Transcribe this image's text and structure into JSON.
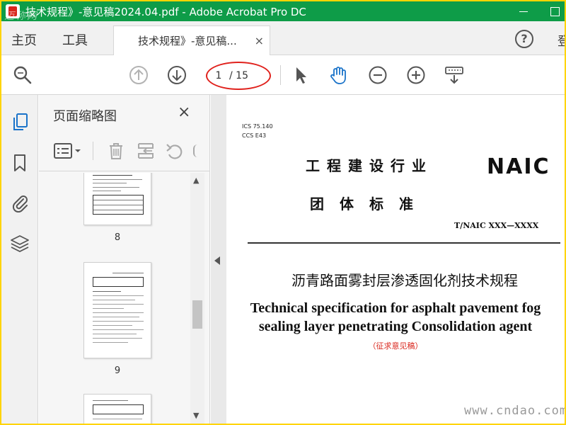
{
  "window": {
    "title": "技术规程》-意见稿2024.04.pdf - Adobe Acrobat Pro DC",
    "watermark": "迈称网"
  },
  "nav": {
    "home": "主页",
    "tools": "工具",
    "doc_tab": "技术规程》-意见稿...",
    "tab_close": "×",
    "help": "?",
    "login": "登"
  },
  "toolbar": {
    "current_page": "1",
    "total_pages": "/ 15",
    "icons": [
      "search-icon",
      "page-up-icon",
      "page-down-icon",
      "select-pointer-icon",
      "hand-tool-icon",
      "zoom-out-icon",
      "zoom-in-icon",
      "keyboard-scroll-icon"
    ]
  },
  "left_strip": {
    "icons": [
      "page-thumbnails-icon",
      "bookmark-icon",
      "attachment-icon",
      "layers-icon"
    ]
  },
  "thumbnail_panel": {
    "title": "页面缩略图",
    "close": "×",
    "tools": [
      "options-menu-icon",
      "delete-icon",
      "insert-page-icon",
      "undo-icon"
    ],
    "pages": [
      "8",
      "9"
    ]
  },
  "document": {
    "codes": [
      "ICS 75.140",
      "CCS E43"
    ],
    "heading_line1": "工程建设行业",
    "heading_line2": "团体标准",
    "org": "NAIC",
    "standard_no": "T/NAIC XXX—XXXX",
    "title_cn": "沥青路面雾封层渗透固化剂技术规程",
    "title_en_line1": "Technical specification for asphalt pavement fog",
    "title_en_line2": "sealing layer penetrating Consolidation agent",
    "note": "（征求意见稿）",
    "watermark": "www.cndao.com"
  },
  "colors": {
    "titlebar": "#0e9c48",
    "accent": "#1a73c9",
    "highlight": "#e0211c",
    "frame": "#ffd400"
  }
}
